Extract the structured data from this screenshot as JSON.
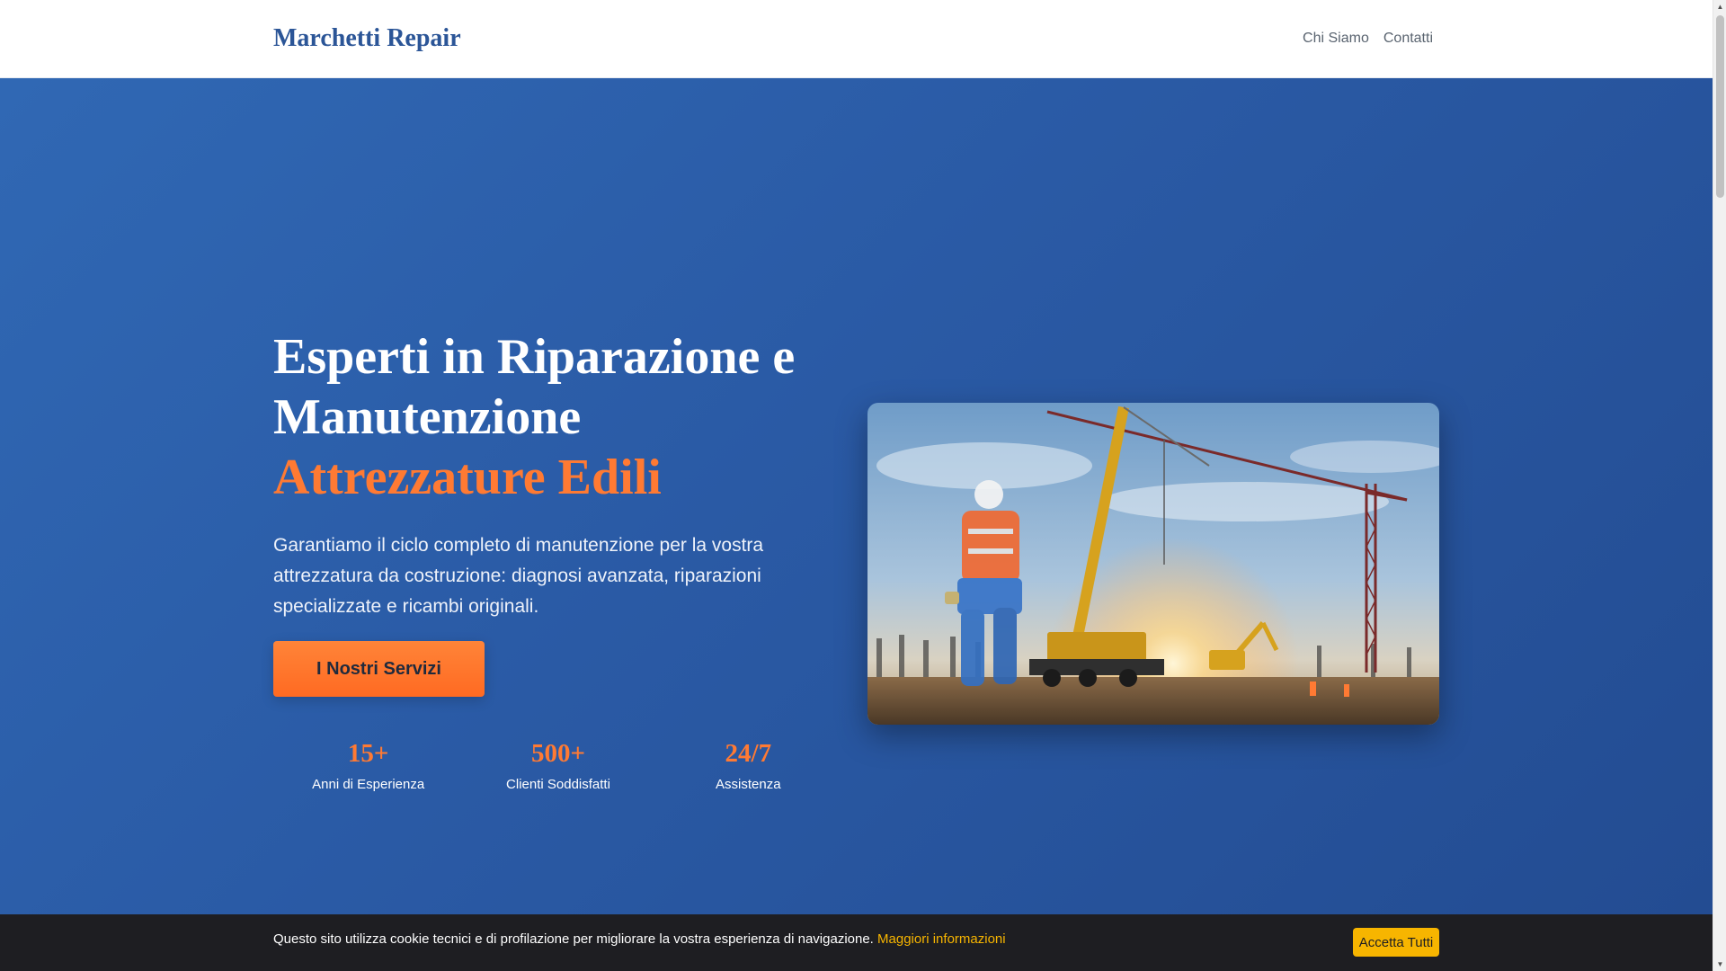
{
  "header": {
    "brand": "Marchetti Repair",
    "nav": [
      "Chi Siamo",
      "Contatti"
    ]
  },
  "hero": {
    "title_line1": "Esperti in Riparazione e",
    "title_line2": "Manutenzione",
    "title_accent": "Attrezzature Edili",
    "description": "Garantiamo il ciclo completo di manutenzione per la vostra attrezzatura da costruzione: diagnosi avanzata, riparazioni specializzate e ricambi originali.",
    "cta_label": "I Nostri Servizi",
    "stats": [
      {
        "value": "15+",
        "label": "Anni di Esperienza"
      },
      {
        "value": "500+",
        "label": "Clienti Soddisfatti"
      },
      {
        "value": "24/7",
        "label": "Assistenza"
      }
    ],
    "image_icon": "construction-site-image"
  },
  "cookie": {
    "text": "Questo sito utilizza cookie tecnici e di profilazione per migliorare la vostra esperienza di navigazione.",
    "link": "Maggiori informazioni",
    "accept_label": "Accetta Tutti"
  },
  "colors": {
    "brand": "#2b5597",
    "accent": "#ff7a33",
    "hero_bg": "#2a5aa5",
    "cookie_bg": "#1e1e22",
    "cookie_accent": "#f7b500"
  }
}
